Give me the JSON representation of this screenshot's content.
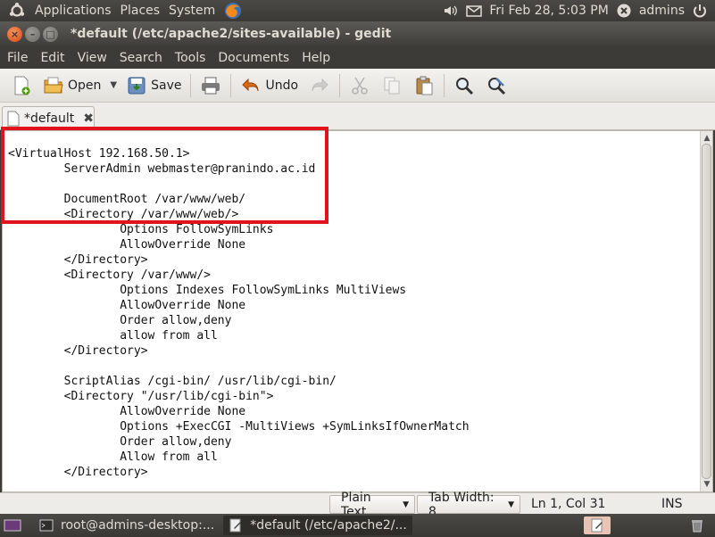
{
  "top_panel": {
    "menus": [
      "Applications",
      "Places",
      "System"
    ],
    "datetime": "Fri Feb 28,  5:03 PM",
    "user": "admins"
  },
  "window": {
    "title": "*default (/etc/apache2/sites-available) - gedit"
  },
  "menubar": [
    "File",
    "Edit",
    "View",
    "Search",
    "Tools",
    "Documents",
    "Help"
  ],
  "toolbar": {
    "open_label": "Open",
    "save_label": "Save",
    "undo_label": "Undo"
  },
  "tab": {
    "label": "*default"
  },
  "editor": {
    "lines": [
      "<VirtualHost 192.168.50.1>",
      "        ServerAdmin webmaster@pranindo.ac.id",
      "",
      "        DocumentRoot /var/www/web/",
      "        <Directory /var/www/web/>",
      "                Options FollowSymLinks",
      "                AllowOverride None",
      "        </Directory>",
      "        <Directory /var/www/>",
      "                Options Indexes FollowSymLinks MultiViews",
      "                AllowOverride None",
      "                Order allow,deny",
      "                allow from all",
      "        </Directory>",
      "",
      "        ScriptAlias /cgi-bin/ /usr/lib/cgi-bin/",
      "        <Directory \"/usr/lib/cgi-bin\">",
      "                AllowOverride None",
      "                Options +ExecCGI -MultiViews +SymLinksIfOwnerMatch",
      "                Order allow,deny",
      "                Allow from all",
      "        </Directory>"
    ]
  },
  "statusbar": {
    "language": "Plain Text",
    "tab_width": "Tab Width:  8",
    "position": "Ln 1, Col 31",
    "mode": "INS"
  },
  "taskbar": {
    "tasks": [
      "root@admins-desktop:...",
      "*default (/etc/apache2/..."
    ]
  },
  "colors": {
    "highlight_box": "#e0141c",
    "panel": "#3c3b37"
  }
}
